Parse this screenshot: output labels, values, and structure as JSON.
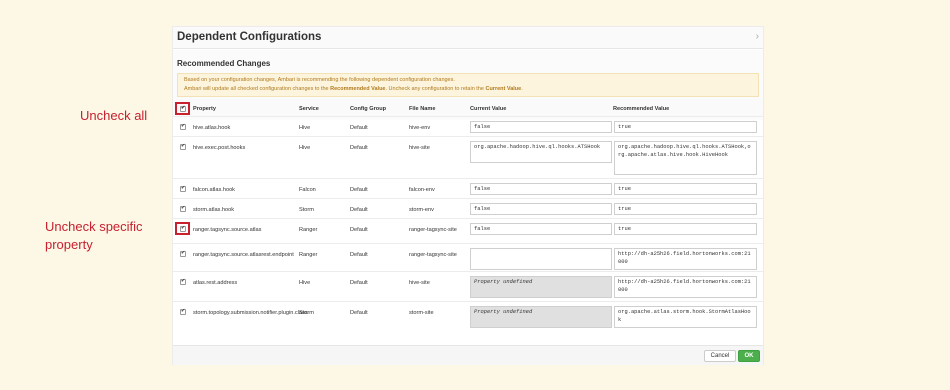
{
  "annotations": {
    "uncheck_all": "Uncheck all",
    "uncheck_specific": "Uncheck specific property"
  },
  "dialog": {
    "title": "Dependent Configurations",
    "section_title": "Recommended Changes",
    "alert_line1": "Based on your configuration changes, Ambari is recommending the following dependent configuration changes.",
    "alert_line2_pre": "Ambari will update all checked configuration changes to the ",
    "alert_line2_rec": "Recommended Value",
    "alert_line2_mid": ". Uncheck any configuration to retain the ",
    "alert_line2_cur": "Current Value",
    "alert_line2_end": ".",
    "cancel_label": "Cancel",
    "ok_label": "OK"
  },
  "table": {
    "headers": {
      "property": "Property",
      "service": "Service",
      "config_group": "Config Group",
      "file_name": "File Name",
      "current_value": "Current Value",
      "recommended_value": "Recommended Value"
    },
    "rows": [
      {
        "property": "hive.atlas.hook",
        "service": "Hive",
        "group": "Default",
        "file": "hive-env",
        "current": "false",
        "recommended": "true",
        "checked": true
      },
      {
        "property": "hive.exec.post.hooks",
        "service": "Hive",
        "group": "Default",
        "file": "hive-site",
        "current": "org.apache.hadoop.hive.ql.hooks.ATSHook",
        "recommended": "org.apache.hadoop.hive.ql.hooks.ATSHook,org.apache.atlas.hive.hook.HiveHook",
        "checked": true
      },
      {
        "property": "falcon.atlas.hook",
        "service": "Falcon",
        "group": "Default",
        "file": "falcon-env",
        "current": "false",
        "recommended": "true",
        "checked": true
      },
      {
        "property": "storm.atlas.hook",
        "service": "Storm",
        "group": "Default",
        "file": "storm-env",
        "current": "false",
        "recommended": "true",
        "checked": true
      },
      {
        "property": "ranger.tagsync.source.atlas",
        "service": "Ranger",
        "group": "Default",
        "file": "ranger-tagsync-site",
        "current": "false",
        "recommended": "true",
        "checked": true
      },
      {
        "property": "ranger.tagsync.source.atlasrest.endpoint",
        "service": "Ranger",
        "group": "Default",
        "file": "ranger-tagsync-site",
        "current": "",
        "recommended": "http://dh-a25h26.field.hortonworks.com:21000",
        "checked": true
      },
      {
        "property": "atlas.rest.address",
        "service": "Hive",
        "group": "Default",
        "file": "hive-site",
        "current": "Property undefined",
        "recommended": "http://dh-a25h26.field.hortonworks.com:21000",
        "checked": true
      },
      {
        "property": "storm.topology.submission.notifier.plugin.class",
        "service": "Storm",
        "group": "Default",
        "file": "storm-site",
        "current": "Property undefined",
        "recommended": "org.apache.atlas.storm.hook.StormAtlasHook",
        "checked": true
      }
    ]
  },
  "colors": {
    "page_bg": "#fdf8e6",
    "annotation": "#c8202f",
    "alert_bg": "#fcf4dc",
    "alert_text": "#b07a1e",
    "ok_button": "#4cae4c"
  }
}
